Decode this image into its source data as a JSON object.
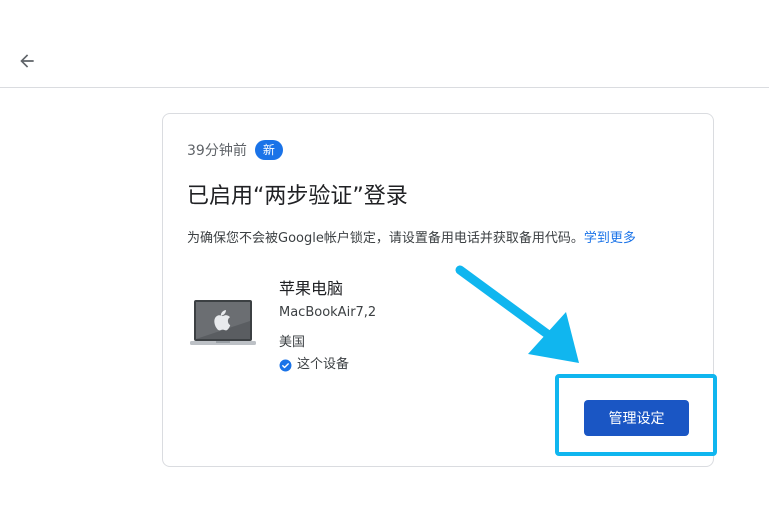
{
  "header": {
    "back_icon": "arrow-left-icon"
  },
  "card": {
    "time": "39分钟前",
    "badge": "新",
    "title": "已启用“两步验证”登录",
    "description": "为确保您不会被Google帐户锁定，请设置备用电话并获取备用代码。",
    "learn_more": "学到更多",
    "device": {
      "icon": "laptop-icon",
      "name": "苹果电脑",
      "model": "MacBookAir7,2",
      "country": "美国",
      "this_device": "这个设备",
      "check_icon": "check-circle-icon"
    },
    "manage_button": "管理设定"
  },
  "annotation": {
    "arrow_color": "#10b6ef",
    "highlight_color": "#10b6ef"
  },
  "colors": {
    "accent": "#1a73e8",
    "button": "#1a56c4",
    "border": "#dadce0"
  }
}
